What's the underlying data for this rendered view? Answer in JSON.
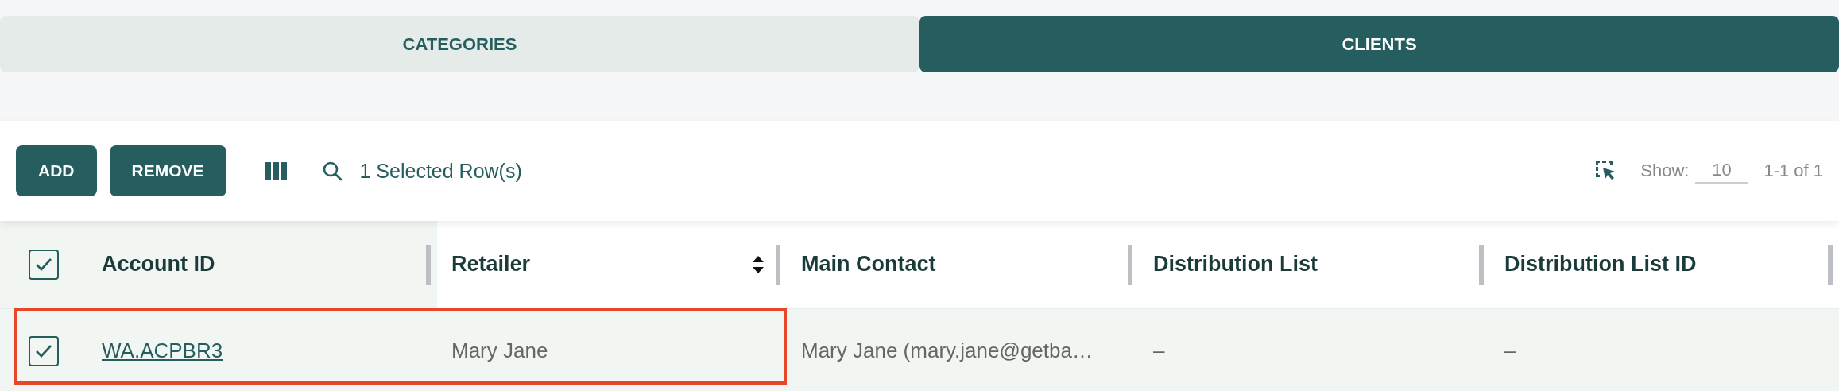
{
  "tabs": [
    {
      "label": "CATEGORIES",
      "selected": false
    },
    {
      "label": "CLIENTS",
      "selected": true
    }
  ],
  "toolbar": {
    "buttons": [
      "ADD",
      "REMOVE"
    ],
    "selection_text": "1 Selected Row(s)",
    "show_label": "Show:",
    "page_size": "10",
    "range": "1-1 of 1"
  },
  "table": {
    "all_checked": true,
    "columns": [
      {
        "label": "Account ID",
        "sortable": false
      },
      {
        "label": "Retailer",
        "sortable": true
      },
      {
        "label": "Main Contact",
        "sortable": false
      },
      {
        "label": "Distribution List",
        "sortable": false
      },
      {
        "label": "Distribution List ID",
        "sortable": false
      }
    ],
    "rows": [
      {
        "checked": true,
        "highlighted": true,
        "cells": [
          "WA.ACPBR3",
          "Mary Jane",
          "Mary Jane (mary.jane@getba…",
          "–",
          "–"
        ]
      }
    ]
  }
}
